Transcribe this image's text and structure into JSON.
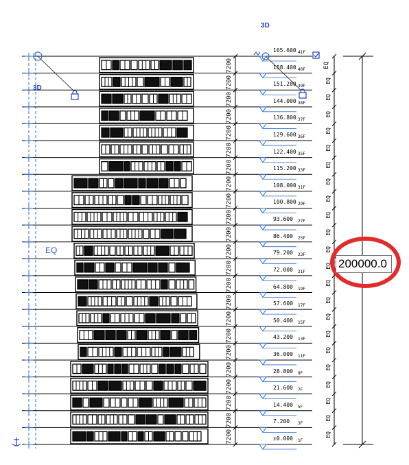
{
  "view_labels": {
    "top_3d": "3D",
    "left_3d": "3D",
    "left_eq": "EQ",
    "right_top_eq": "EQ",
    "right_partial": "EQ"
  },
  "temporary_dimension": {
    "value": "200000.0",
    "highlight_color": "#e22b2b"
  },
  "colors": {
    "line": "#000000",
    "grid_dash": "#2a6fd6",
    "level_marker": "#2a6fd6",
    "text_3d": "#1f3fbf"
  },
  "levels": [
    {
      "elev": "165.600",
      "name": "41F"
    },
    {
      "elev": "158.400",
      "name": "40F"
    },
    {
      "elev": "151.200",
      "name": "39F"
    },
    {
      "elev": "144.000",
      "name": "38F"
    },
    {
      "elev": "136.800",
      "name": "37F"
    },
    {
      "elev": "129.600",
      "name": "36F"
    },
    {
      "elev": "122.400",
      "name": "35F"
    },
    {
      "elev": "115.200",
      "name": "33F"
    },
    {
      "elev": "108.000",
      "name": "31F"
    },
    {
      "elev": "100.800",
      "name": "29F"
    },
    {
      "elev": "93.600",
      "name": "27F"
    },
    {
      "elev": "86.400",
      "name": "25F"
    },
    {
      "elev": "79.200",
      "name": "23F"
    },
    {
      "elev": "72.000",
      "name": "21F"
    },
    {
      "elev": "64.800",
      "name": "19F"
    },
    {
      "elev": "57.600",
      "name": "17F"
    },
    {
      "elev": "50.400",
      "name": "15F"
    },
    {
      "elev": "43.200",
      "name": "13F"
    },
    {
      "elev": "36.000",
      "name": "11F"
    },
    {
      "elev": "28.800",
      "name": "9F"
    },
    {
      "elev": "21.600",
      "name": "7F"
    },
    {
      "elev": "14.400",
      "name": "5F"
    },
    {
      "elev": "7.200",
      "name": "3F"
    },
    {
      "elev": "±0.000",
      "name": "1F"
    }
  ],
  "floor_dimension": "7200",
  "eq_label": "EQ",
  "icons": [
    "lock-icon",
    "lock-icon",
    "grid-head-icon",
    "section-head-icon",
    "anchor-icon",
    "checkbox-icon"
  ]
}
